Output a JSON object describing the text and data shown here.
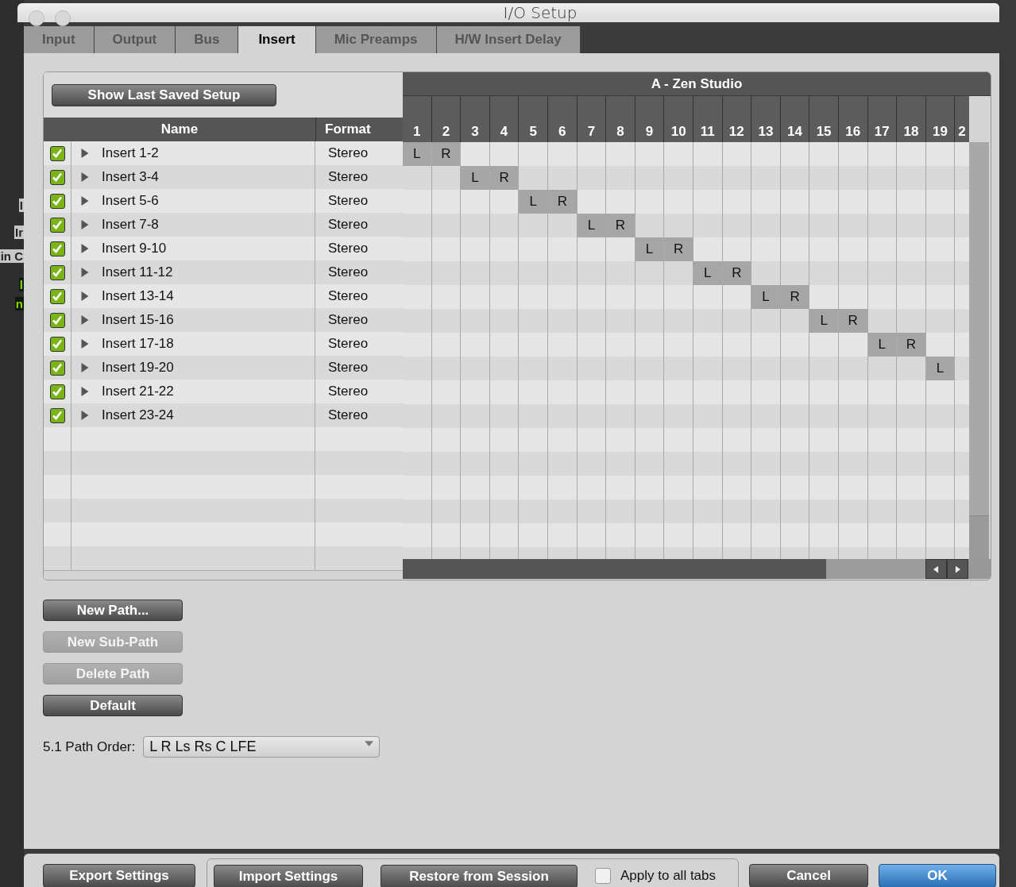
{
  "background_app": {
    "fragments": [
      "I",
      "Ir",
      "in C",
      "l",
      "n"
    ]
  },
  "window": {
    "title": "I/O Setup"
  },
  "tabs": [
    {
      "label": "Input",
      "selected": false
    },
    {
      "label": "Output",
      "selected": false
    },
    {
      "label": "Bus",
      "selected": false
    },
    {
      "label": "Insert",
      "selected": true
    },
    {
      "label": "Mic Preamps",
      "selected": false
    },
    {
      "label": "H/W Insert Delay",
      "selected": false
    }
  ],
  "show_last_saved_setup": "Show Last Saved Setup",
  "table": {
    "columns": [
      "Name",
      "Format"
    ],
    "rows": [
      {
        "checked": true,
        "expanded": false,
        "name": "Insert 1-2",
        "format": "Stereo"
      },
      {
        "checked": true,
        "expanded": false,
        "name": "Insert 3-4",
        "format": "Stereo"
      },
      {
        "checked": true,
        "expanded": false,
        "name": "Insert 5-6",
        "format": "Stereo"
      },
      {
        "checked": true,
        "expanded": false,
        "name": "Insert 7-8",
        "format": "Stereo"
      },
      {
        "checked": true,
        "expanded": false,
        "name": "Insert 9-10",
        "format": "Stereo"
      },
      {
        "checked": true,
        "expanded": false,
        "name": "Insert 11-12",
        "format": "Stereo"
      },
      {
        "checked": true,
        "expanded": false,
        "name": "Insert 13-14",
        "format": "Stereo"
      },
      {
        "checked": true,
        "expanded": false,
        "name": "Insert 15-16",
        "format": "Stereo"
      },
      {
        "checked": true,
        "expanded": false,
        "name": "Insert 17-18",
        "format": "Stereo"
      },
      {
        "checked": true,
        "expanded": false,
        "name": "Insert 19-20",
        "format": "Stereo"
      },
      {
        "checked": true,
        "expanded": false,
        "name": "Insert 21-22",
        "format": "Stereo"
      },
      {
        "checked": true,
        "expanded": false,
        "name": "Insert 23-24",
        "format": "Stereo"
      }
    ]
  },
  "grid": {
    "device": "A - Zen Studio",
    "columns": [
      "1",
      "2",
      "3",
      "4",
      "5",
      "6",
      "7",
      "8",
      "9",
      "10",
      "11",
      "12",
      "13",
      "14",
      "15",
      "16",
      "17",
      "18",
      "19",
      "2"
    ],
    "rows": [
      [
        "L",
        "R",
        null,
        null,
        null,
        null,
        null,
        null,
        null,
        null,
        null,
        null,
        null,
        null,
        null,
        null,
        null,
        null,
        null,
        null
      ],
      [
        null,
        null,
        "L",
        "R",
        null,
        null,
        null,
        null,
        null,
        null,
        null,
        null,
        null,
        null,
        null,
        null,
        null,
        null,
        null,
        null
      ],
      [
        null,
        null,
        null,
        null,
        "L",
        "R",
        null,
        null,
        null,
        null,
        null,
        null,
        null,
        null,
        null,
        null,
        null,
        null,
        null,
        null
      ],
      [
        null,
        null,
        null,
        null,
        null,
        null,
        "L",
        "R",
        null,
        null,
        null,
        null,
        null,
        null,
        null,
        null,
        null,
        null,
        null,
        null
      ],
      [
        null,
        null,
        null,
        null,
        null,
        null,
        null,
        null,
        "L",
        "R",
        null,
        null,
        null,
        null,
        null,
        null,
        null,
        null,
        null,
        null
      ],
      [
        null,
        null,
        null,
        null,
        null,
        null,
        null,
        null,
        null,
        null,
        "L",
        "R",
        null,
        null,
        null,
        null,
        null,
        null,
        null,
        null
      ],
      [
        null,
        null,
        null,
        null,
        null,
        null,
        null,
        null,
        null,
        null,
        null,
        null,
        "L",
        "R",
        null,
        null,
        null,
        null,
        null,
        null
      ],
      [
        null,
        null,
        null,
        null,
        null,
        null,
        null,
        null,
        null,
        null,
        null,
        null,
        null,
        null,
        "L",
        "R",
        null,
        null,
        null,
        null
      ],
      [
        null,
        null,
        null,
        null,
        null,
        null,
        null,
        null,
        null,
        null,
        null,
        null,
        null,
        null,
        null,
        null,
        "L",
        "R",
        null,
        null
      ],
      [
        null,
        null,
        null,
        null,
        null,
        null,
        null,
        null,
        null,
        null,
        null,
        null,
        null,
        null,
        null,
        null,
        null,
        null,
        "L",
        null
      ],
      [
        null,
        null,
        null,
        null,
        null,
        null,
        null,
        null,
        null,
        null,
        null,
        null,
        null,
        null,
        null,
        null,
        null,
        null,
        null,
        null
      ],
      [
        null,
        null,
        null,
        null,
        null,
        null,
        null,
        null,
        null,
        null,
        null,
        null,
        null,
        null,
        null,
        null,
        null,
        null,
        null,
        null
      ]
    ]
  },
  "path_buttons": [
    {
      "label": "New Path...",
      "disabled": false
    },
    {
      "label": "New Sub-Path",
      "disabled": true
    },
    {
      "label": "Delete Path",
      "disabled": true
    },
    {
      "label": "Default",
      "disabled": false
    }
  ],
  "path_order": {
    "label": "5.1 Path Order:",
    "value": "L R Ls Rs C LFE"
  },
  "footer": {
    "export": "Export Settings",
    "import": "Import Settings",
    "restore": "Restore from Session",
    "apply_all": {
      "label": "Apply to all tabs",
      "checked": false
    },
    "cancel": "Cancel",
    "ok": "OK"
  }
}
